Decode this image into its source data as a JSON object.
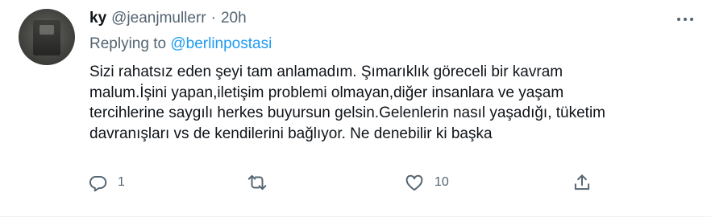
{
  "tweet": {
    "display_name": "ky",
    "handle": "@jeanjmullerr",
    "separator": "·",
    "timestamp": "20h",
    "replying_to_label": "Replying to",
    "replying_to_handle": "@berlinpostasi",
    "text_lines": [
      "Sizi rahatsız eden şeyi tam anlamadım. Şımarıklık göreceli bir kavram",
      "malum.İşini yapan,iletişim problemi olmayan,diğer insanlara ve yaşam",
      "tercihlerine saygılı herkes buyursun gelsin.Gelenlerin nasıl yaşadığı, tüketim",
      "davranışları vs de kendilerini bağlıyor. Ne denebilir ki başka"
    ],
    "actions": {
      "reply_count": "1",
      "retweet_count": "",
      "like_count": "10",
      "share_count": ""
    }
  },
  "icons": {
    "more": "more-icon",
    "reply": "reply-icon",
    "retweet": "retweet-icon",
    "like": "heart-icon",
    "share": "share-icon"
  },
  "colors": {
    "text": "#0f1419",
    "secondary": "#536471",
    "link": "#1d9bf0"
  }
}
